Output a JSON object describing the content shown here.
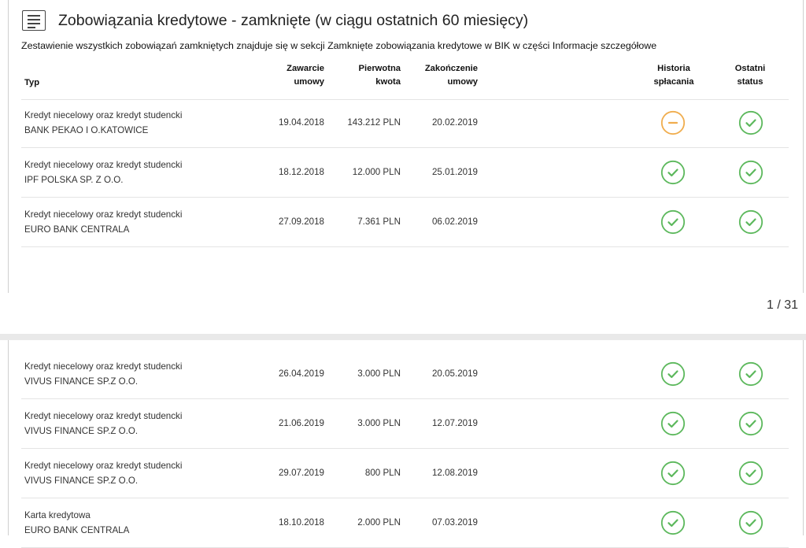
{
  "section": {
    "title": "Zobowiązania kredytowe - zamknięte (w ciągu ostatnich 60 miesięcy)",
    "subtitle": "Zestawienie wszystkich zobowiązań zamkniętych znajduje się w sekcji Zamknięte zobowiązania kredytowe w BIK w części Informacje szczegółowe",
    "icon": "document-list-icon"
  },
  "table": {
    "headers": {
      "type": "Typ",
      "opened_l1": "Zawarcie",
      "opened_l2": "umowy",
      "amount_l1": "Pierwotna",
      "amount_l2": "kwota",
      "closed_l1": "Zakończenie",
      "closed_l2": "umowy",
      "history_l1": "Historia",
      "history_l2": "spłacania",
      "status_l1": "Ostatni",
      "status_l2": "status"
    },
    "rows_page1": [
      {
        "type": "Kredyt niecelowy oraz kredyt studencki",
        "lender": "BANK PEKAO I O.KATOWICE",
        "opened": "19.04.2018",
        "amount": "143.212 PLN",
        "closed": "20.02.2019",
        "history": "warning",
        "status": "ok"
      },
      {
        "type": "Kredyt niecelowy oraz kredyt studencki",
        "lender": "IPF POLSKA SP. Z O.O.",
        "opened": "18.12.2018",
        "amount": "12.000 PLN",
        "closed": "25.01.2019",
        "history": "ok",
        "status": "ok"
      },
      {
        "type": "Kredyt niecelowy oraz kredyt studencki",
        "lender": "EURO BANK CENTRALA",
        "opened": "27.09.2018",
        "amount": "7.361 PLN",
        "closed": "06.02.2019",
        "history": "ok",
        "status": "ok"
      }
    ],
    "rows_page2": [
      {
        "type": "Kredyt niecelowy oraz kredyt studencki",
        "lender": "VIVUS FINANCE SP.Z O.O.",
        "opened": "26.04.2019",
        "amount": "3.000 PLN",
        "closed": "20.05.2019",
        "history": "ok",
        "status": "ok"
      },
      {
        "type": "Kredyt niecelowy oraz kredyt studencki",
        "lender": "VIVUS FINANCE SP.Z O.O.",
        "opened": "21.06.2019",
        "amount": "3.000 PLN",
        "closed": "12.07.2019",
        "history": "ok",
        "status": "ok"
      },
      {
        "type": "Kredyt niecelowy oraz kredyt studencki",
        "lender": "VIVUS FINANCE SP.Z O.O.",
        "opened": "29.07.2019",
        "amount": "800 PLN",
        "closed": "12.08.2019",
        "history": "ok",
        "status": "ok"
      },
      {
        "type": "Karta kredytowa",
        "lender": "EURO BANK CENTRALA",
        "opened": "18.10.2018",
        "amount": "2.000 PLN",
        "closed": "07.03.2019",
        "history": "ok",
        "status": "ok"
      }
    ]
  },
  "colors": {
    "ok": "#5cb85c",
    "warning": "#f0ad4e"
  },
  "pager": {
    "label": "1 / 31"
  }
}
